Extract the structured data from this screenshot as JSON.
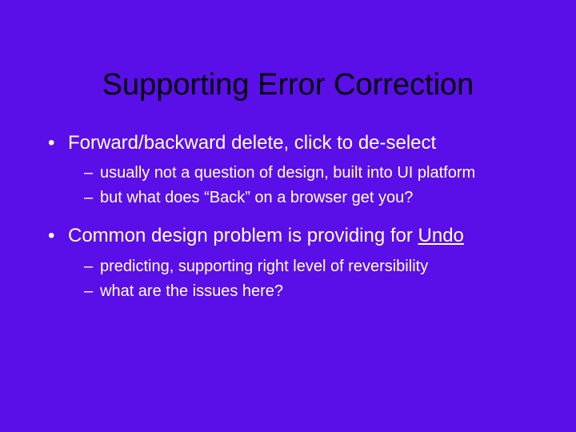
{
  "slide": {
    "title": "Supporting Error Correction",
    "bullets": [
      {
        "text": "Forward/backward delete, click to de-select",
        "sub": [
          "usually not a question of design, built into UI platform",
          "but what does “Back” on a browser get you?"
        ]
      },
      {
        "text_prefix": "Common design problem is providing for ",
        "text_underlined": "Undo",
        "sub": [
          "predicting, supporting right level of reversibility",
          "what are the issues here?"
        ]
      }
    ]
  }
}
